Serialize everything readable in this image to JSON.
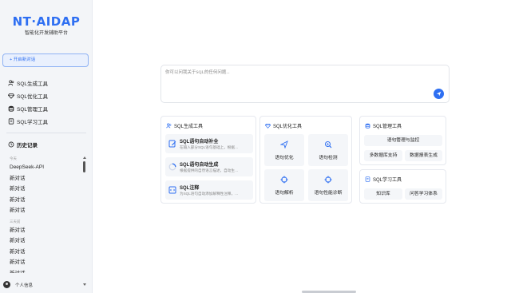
{
  "brand": {
    "logo": "NT·AIDAP",
    "subtitle": "智能化开发辅助平台"
  },
  "sidebar": {
    "new_chat": "+ 开启新对话",
    "nav": [
      {
        "label": "SQL生成工具",
        "icon": "users-icon"
      },
      {
        "label": "SQL优化工具",
        "icon": "gem-icon"
      },
      {
        "label": "SQL管理工具",
        "icon": "database-icon"
      },
      {
        "label": "SQL学习工具",
        "icon": "book-icon"
      }
    ],
    "history_title": "历史记录",
    "history": {
      "today_label": "今天",
      "today": [
        "DeepSeek-API",
        "新对话",
        "新对话",
        "新对话",
        "新对话"
      ],
      "three_days_label": "三天前",
      "three_days": [
        "新对话",
        "新对话",
        "新对话",
        "新对话",
        "新对话"
      ]
    },
    "profile": "个人信息"
  },
  "main": {
    "input_placeholder": "你可以问我关于SQL的任何问题...",
    "gen_card": {
      "title": "SQL生成工具",
      "items": [
        {
          "title": "SQL语句自动补全",
          "desc": "在输入部分SQL语句基础上，根据…",
          "icon": "edit-icon"
        },
        {
          "title": "SQL语句自动生成",
          "desc": "根据提供的自然语言描述，自动生…",
          "icon": "spinner-icon"
        },
        {
          "title": "SQL注释",
          "desc": "为SQL语句自动添加解释性注释，…",
          "icon": "code-comment-icon"
        }
      ]
    },
    "opt_card": {
      "title": "SQL优化工具",
      "tiles": [
        {
          "label": "语句优化",
          "icon": "send-icon"
        },
        {
          "label": "语句检测",
          "icon": "zoom-icon"
        },
        {
          "label": "语句解析",
          "icon": "crosshair-icon"
        },
        {
          "label": "语句性能诊断",
          "icon": "crosshair-icon"
        }
      ]
    },
    "mgmt_card": {
      "title": "SQL管理工具",
      "chips": [
        "语句管理与监控",
        "多数据库支持",
        "数据报表生成"
      ]
    },
    "learn_card": {
      "title": "SQL学习工具",
      "chips": [
        "知识库",
        "问答学习体系"
      ]
    }
  },
  "colors": {
    "accent": "#2e6ff2",
    "sidebar_bg": "#f3f5f8",
    "tile_bg": "#f4f6f9"
  }
}
